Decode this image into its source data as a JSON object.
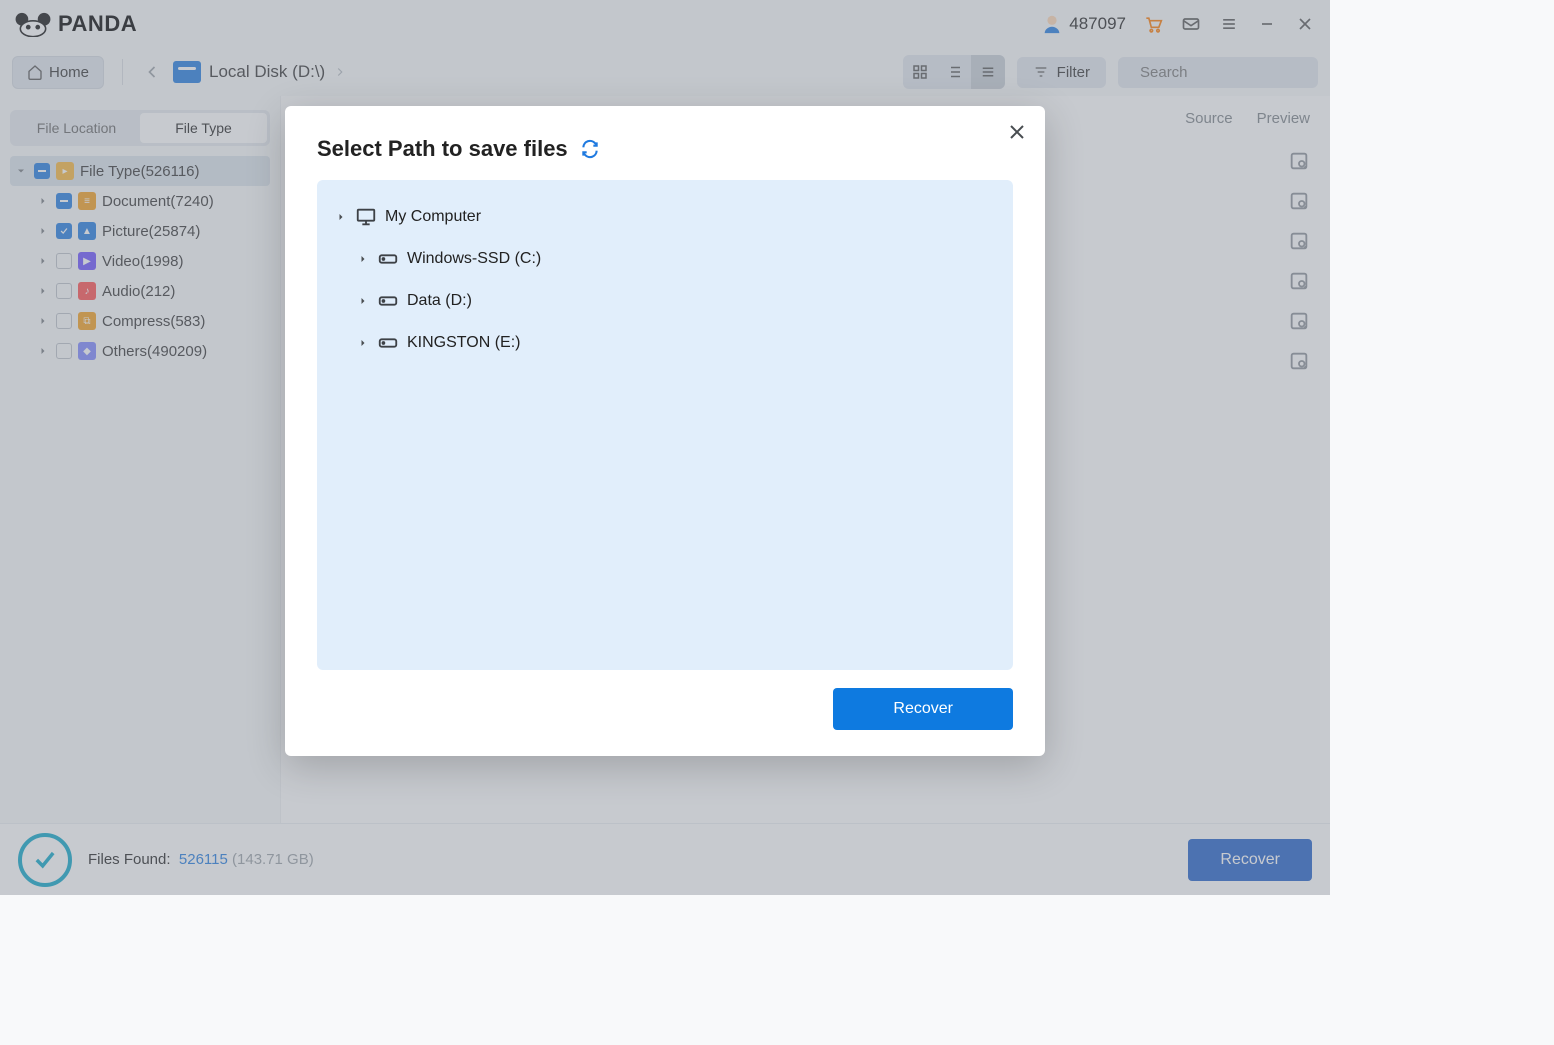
{
  "app": {
    "name": "PANDA",
    "user_id": "487097"
  },
  "toolbar": {
    "home_label": "Home",
    "breadcrumb_label": "Local Disk (D:\\)",
    "filter_label": "Filter",
    "search_placeholder": "Search"
  },
  "sidebar": {
    "tabs": {
      "location": "File Location",
      "type": "File Type"
    },
    "root": {
      "label": "File Type(526116)"
    },
    "nodes": [
      {
        "label": "Document(7240)"
      },
      {
        "label": "Picture(25874)"
      },
      {
        "label": "Video(1998)"
      },
      {
        "label": "Audio(212)"
      },
      {
        "label": "Compress(583)"
      },
      {
        "label": "Others(490209)"
      }
    ]
  },
  "content": {
    "col_source": "Source",
    "col_preview": "Preview"
  },
  "footer": {
    "files_found_label": "Files Found:",
    "count": "526115",
    "size": "(143.71 GB)",
    "recover_label": "Recover"
  },
  "modal": {
    "title": "Select Path to save files",
    "root": "My Computer",
    "drives": [
      "Windows-SSD (C:)",
      "Data (D:)",
      "KINGSTON (E:)"
    ],
    "recover_label": "Recover"
  }
}
